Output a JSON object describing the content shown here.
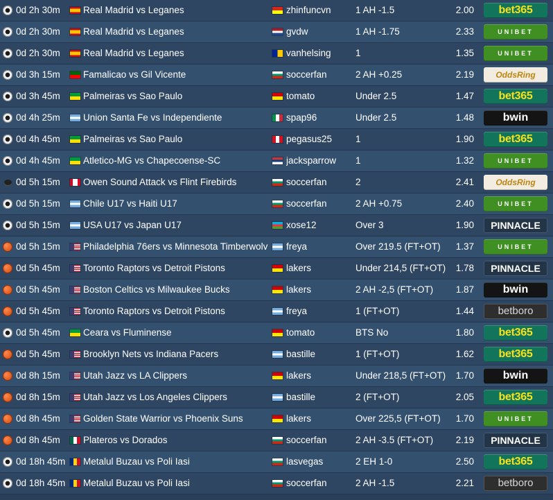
{
  "sport_icons": {
    "soccer": "soccer-ball-icon",
    "basketball": "basketball-icon",
    "hockey": "hockey-puck-icon"
  },
  "flag_colors": {
    "ES": [
      "#c60b1e",
      "#ffc400",
      "#c60b1e"
    ],
    "PT": [
      "#006600",
      "#ff0000"
    ],
    "BR": [
      "#009b3a",
      "#fedf00"
    ],
    "AR": [
      "#74acdf",
      "#ffffff",
      "#74acdf"
    ],
    "CA": [
      "#d80621",
      "#ffffff",
      "#d80621"
    ],
    "US": [
      "#b22234",
      "#ffffff",
      "#3c3b6e"
    ],
    "MX": [
      "#006847",
      "#ffffff",
      "#ce1126"
    ],
    "RO": [
      "#002b7f",
      "#fcd116",
      "#ce1126"
    ],
    "VN": [
      "#da251d",
      "#ffff00"
    ],
    "NL": [
      "#ae1c28",
      "#ffffff",
      "#21468b"
    ],
    "BA": [
      "#002395",
      "#fecb00"
    ],
    "BG": [
      "#ffffff",
      "#00966e",
      "#d62612"
    ],
    "MK": [
      "#d20000",
      "#ffe600"
    ],
    "IT": [
      "#009246",
      "#ffffff",
      "#ce2b37"
    ],
    "PE": [
      "#d91023",
      "#ffffff",
      "#d91023"
    ],
    "RS": [
      "#c6363c",
      "#0c4076",
      "#ffffff"
    ],
    "AZ": [
      "#00b5e2",
      "#ef3340",
      "#509e2f"
    ]
  },
  "bookmaker_styles": {
    "bet365": "bm-bet365",
    "unibet": "bm-unibet",
    "oddsring": "bm-oddsring",
    "pinnacle": "bm-pinnacle",
    "bwin": "bm-bwin",
    "betboro": "bm-betboro"
  },
  "rows": [
    {
      "sport": "soccer",
      "time": "0d 2h 30m",
      "match_flag": "ES",
      "match": "Real Madrid vs Leganes",
      "user_flag": "VN",
      "user": "zhinfuncvn",
      "pick": "1 AH -1.5",
      "odds": "2.00",
      "bookmaker": "bet365",
      "bookmaker_label": "bet365"
    },
    {
      "sport": "soccer",
      "time": "0d 2h 30m",
      "match_flag": "ES",
      "match": "Real Madrid vs Leganes",
      "user_flag": "NL",
      "user": "gvdw",
      "pick": "1 AH -1.75",
      "odds": "2.33",
      "bookmaker": "unibet",
      "bookmaker_label": "UNIBET"
    },
    {
      "sport": "soccer",
      "time": "0d 2h 30m",
      "match_flag": "ES",
      "match": "Real Madrid vs Leganes",
      "user_flag": "BA",
      "user": "vanhelsing",
      "pick": "1",
      "odds": "1.35",
      "bookmaker": "unibet",
      "bookmaker_label": "UNIBET"
    },
    {
      "sport": "soccer",
      "time": "0d 3h 15m",
      "match_flag": "PT",
      "match": "Famalicao vs Gil Vicente",
      "user_flag": "BG",
      "user": "soccerfan",
      "pick": "2 AH +0.25",
      "odds": "2.19",
      "bookmaker": "oddsring",
      "bookmaker_label": "OddsRing"
    },
    {
      "sport": "soccer",
      "time": "0d 3h 45m",
      "match_flag": "BR",
      "match": "Palmeiras vs Sao Paulo",
      "user_flag": "MK",
      "user": "tomato",
      "pick": "Under 2.5",
      "odds": "1.47",
      "bookmaker": "bet365",
      "bookmaker_label": "bet365"
    },
    {
      "sport": "soccer",
      "time": "0d 4h 25m",
      "match_flag": "AR",
      "match": "Union Santa Fe vs Independiente",
      "user_flag": "IT",
      "user": "spap96",
      "pick": "Under 2.5",
      "odds": "1.48",
      "bookmaker": "bwin",
      "bookmaker_label": "bwin"
    },
    {
      "sport": "soccer",
      "time": "0d 4h 45m",
      "match_flag": "BR",
      "match": "Palmeiras vs Sao Paulo",
      "user_flag": "PE",
      "user": "pegasus25",
      "pick": "1",
      "odds": "1.90",
      "bookmaker": "bet365",
      "bookmaker_label": "bet365"
    },
    {
      "sport": "soccer",
      "time": "0d 4h 45m",
      "match_flag": "BR",
      "match": "Atletico-MG vs Chapecoense-SC",
      "user_flag": "RS",
      "user": "jacksparrow",
      "pick": "1",
      "odds": "1.32",
      "bookmaker": "unibet",
      "bookmaker_label": "UNIBET"
    },
    {
      "sport": "hockey",
      "time": "0d 5h 15m",
      "match_flag": "CA",
      "match": "Owen Sound Attack vs Flint Firebirds",
      "user_flag": "BG",
      "user": "soccerfan",
      "pick": "2",
      "odds": "2.41",
      "bookmaker": "oddsring",
      "bookmaker_label": "OddsRing"
    },
    {
      "sport": "soccer",
      "time": "0d 5h 15m",
      "match_flag": "AR",
      "match": "Chile U17 vs Haiti U17",
      "user_flag": "BG",
      "user": "soccerfan",
      "pick": "2 AH +0.75",
      "odds": "2.40",
      "bookmaker": "unibet",
      "bookmaker_label": "UNIBET"
    },
    {
      "sport": "soccer",
      "time": "0d 5h 15m",
      "match_flag": "AR",
      "match": "USA U17 vs Japan U17",
      "user_flag": "AZ",
      "user": "xose12",
      "pick": "Over 3",
      "odds": "1.90",
      "bookmaker": "pinnacle",
      "bookmaker_label": "PINNACLE"
    },
    {
      "sport": "basketball",
      "time": "0d 5h 15m",
      "match_flag": "US",
      "match": "Philadelphia 76ers vs Minnesota Timberwolv",
      "user_flag": "AR",
      "user": "freya",
      "pick": "Over 219.5 (FT+OT)",
      "odds": "1.37",
      "bookmaker": "unibet",
      "bookmaker_label": "UNIBET"
    },
    {
      "sport": "basketball",
      "time": "0d 5h 45m",
      "match_flag": "US",
      "match": "Toronto Raptors vs Detroit Pistons",
      "user_flag": "MK",
      "user": "lakers",
      "pick": "Under 214,5 (FT+OT)",
      "odds": "1.78",
      "bookmaker": "pinnacle",
      "bookmaker_label": "PINNACLE"
    },
    {
      "sport": "basketball",
      "time": "0d 5h 45m",
      "match_flag": "US",
      "match": "Boston Celtics vs Milwaukee Bucks",
      "user_flag": "MK",
      "user": "lakers",
      "pick": "2 AH -2,5 (FT+OT)",
      "odds": "1.87",
      "bookmaker": "bwin",
      "bookmaker_label": "bwin"
    },
    {
      "sport": "basketball",
      "time": "0d 5h 45m",
      "match_flag": "US",
      "match": "Toronto Raptors vs Detroit Pistons",
      "user_flag": "AR",
      "user": "freya",
      "pick": "1 (FT+OT)",
      "odds": "1.44",
      "bookmaker": "betboro",
      "bookmaker_label": "betboro"
    },
    {
      "sport": "soccer",
      "time": "0d 5h 45m",
      "match_flag": "BR",
      "match": "Ceara vs Fluminense",
      "user_flag": "MK",
      "user": "tomato",
      "pick": "BTS No",
      "odds": "1.80",
      "bookmaker": "bet365",
      "bookmaker_label": "bet365"
    },
    {
      "sport": "basketball",
      "time": "0d 5h 45m",
      "match_flag": "US",
      "match": "Brooklyn Nets vs Indiana Pacers",
      "user_flag": "AR",
      "user": "bastille",
      "pick": "1 (FT+OT)",
      "odds": "1.62",
      "bookmaker": "bet365",
      "bookmaker_label": "bet365"
    },
    {
      "sport": "basketball",
      "time": "0d 8h 15m",
      "match_flag": "US",
      "match": "Utah Jazz vs LA Clippers",
      "user_flag": "MK",
      "user": "lakers",
      "pick": "Under 218,5 (FT+OT)",
      "odds": "1.70",
      "bookmaker": "bwin",
      "bookmaker_label": "bwin"
    },
    {
      "sport": "basketball",
      "time": "0d 8h 15m",
      "match_flag": "US",
      "match": "Utah Jazz vs Los Angeles Clippers",
      "user_flag": "AR",
      "user": "bastille",
      "pick": "2 (FT+OT)",
      "odds": "2.05",
      "bookmaker": "bet365",
      "bookmaker_label": "bet365"
    },
    {
      "sport": "basketball",
      "time": "0d 8h 45m",
      "match_flag": "US",
      "match": "Golden State Warrior vs Phoenix Suns",
      "user_flag": "MK",
      "user": "lakers",
      "pick": "Over 225,5 (FT+OT)",
      "odds": "1.70",
      "bookmaker": "unibet",
      "bookmaker_label": "UNIBET"
    },
    {
      "sport": "basketball",
      "time": "0d 8h 45m",
      "match_flag": "MX",
      "match": "Plateros vs Dorados",
      "user_flag": "BG",
      "user": "soccerfan",
      "pick": "2 AH -3.5 (FT+OT)",
      "odds": "2.19",
      "bookmaker": "pinnacle",
      "bookmaker_label": "PINNACLE"
    },
    {
      "sport": "soccer",
      "time": "0d 18h 45m",
      "match_flag": "RO",
      "match": "Metalul Buzau vs Poli Iasi",
      "user_flag": "BG",
      "user": "lasvegas",
      "pick": "2 EH 1-0",
      "odds": "2.50",
      "bookmaker": "bet365",
      "bookmaker_label": "bet365"
    },
    {
      "sport": "soccer",
      "time": "0d 18h 45m",
      "match_flag": "RO",
      "match": "Metalul Buzau vs Poli Iasi",
      "user_flag": "BG",
      "user": "soccerfan",
      "pick": "2 AH -1.5",
      "odds": "2.21",
      "bookmaker": "betboro",
      "bookmaker_label": "betboro"
    }
  ]
}
